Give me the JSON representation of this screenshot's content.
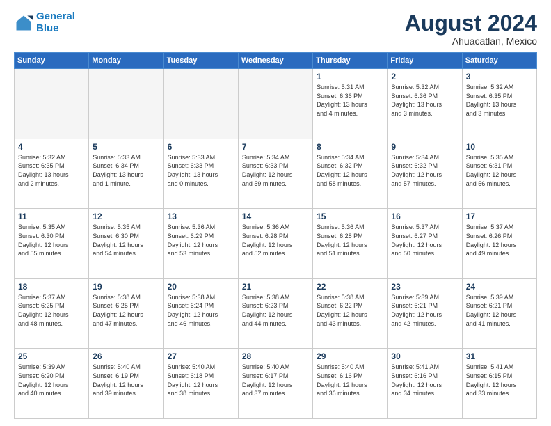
{
  "logo": {
    "line1": "General",
    "line2": "Blue"
  },
  "title": "August 2024",
  "subtitle": "Ahuacatlan, Mexico",
  "days_of_week": [
    "Sunday",
    "Monday",
    "Tuesday",
    "Wednesday",
    "Thursday",
    "Friday",
    "Saturday"
  ],
  "weeks": [
    [
      {
        "day": "",
        "info": ""
      },
      {
        "day": "",
        "info": ""
      },
      {
        "day": "",
        "info": ""
      },
      {
        "day": "",
        "info": ""
      },
      {
        "day": "1",
        "info": "Sunrise: 5:31 AM\nSunset: 6:36 PM\nDaylight: 13 hours\nand 4 minutes."
      },
      {
        "day": "2",
        "info": "Sunrise: 5:32 AM\nSunset: 6:36 PM\nDaylight: 13 hours\nand 3 minutes."
      },
      {
        "day": "3",
        "info": "Sunrise: 5:32 AM\nSunset: 6:35 PM\nDaylight: 13 hours\nand 3 minutes."
      }
    ],
    [
      {
        "day": "4",
        "info": "Sunrise: 5:32 AM\nSunset: 6:35 PM\nDaylight: 13 hours\nand 2 minutes."
      },
      {
        "day": "5",
        "info": "Sunrise: 5:33 AM\nSunset: 6:34 PM\nDaylight: 13 hours\nand 1 minute."
      },
      {
        "day": "6",
        "info": "Sunrise: 5:33 AM\nSunset: 6:33 PM\nDaylight: 13 hours\nand 0 minutes."
      },
      {
        "day": "7",
        "info": "Sunrise: 5:34 AM\nSunset: 6:33 PM\nDaylight: 12 hours\nand 59 minutes."
      },
      {
        "day": "8",
        "info": "Sunrise: 5:34 AM\nSunset: 6:32 PM\nDaylight: 12 hours\nand 58 minutes."
      },
      {
        "day": "9",
        "info": "Sunrise: 5:34 AM\nSunset: 6:32 PM\nDaylight: 12 hours\nand 57 minutes."
      },
      {
        "day": "10",
        "info": "Sunrise: 5:35 AM\nSunset: 6:31 PM\nDaylight: 12 hours\nand 56 minutes."
      }
    ],
    [
      {
        "day": "11",
        "info": "Sunrise: 5:35 AM\nSunset: 6:30 PM\nDaylight: 12 hours\nand 55 minutes."
      },
      {
        "day": "12",
        "info": "Sunrise: 5:35 AM\nSunset: 6:30 PM\nDaylight: 12 hours\nand 54 minutes."
      },
      {
        "day": "13",
        "info": "Sunrise: 5:36 AM\nSunset: 6:29 PM\nDaylight: 12 hours\nand 53 minutes."
      },
      {
        "day": "14",
        "info": "Sunrise: 5:36 AM\nSunset: 6:28 PM\nDaylight: 12 hours\nand 52 minutes."
      },
      {
        "day": "15",
        "info": "Sunrise: 5:36 AM\nSunset: 6:28 PM\nDaylight: 12 hours\nand 51 minutes."
      },
      {
        "day": "16",
        "info": "Sunrise: 5:37 AM\nSunset: 6:27 PM\nDaylight: 12 hours\nand 50 minutes."
      },
      {
        "day": "17",
        "info": "Sunrise: 5:37 AM\nSunset: 6:26 PM\nDaylight: 12 hours\nand 49 minutes."
      }
    ],
    [
      {
        "day": "18",
        "info": "Sunrise: 5:37 AM\nSunset: 6:25 PM\nDaylight: 12 hours\nand 48 minutes."
      },
      {
        "day": "19",
        "info": "Sunrise: 5:38 AM\nSunset: 6:25 PM\nDaylight: 12 hours\nand 47 minutes."
      },
      {
        "day": "20",
        "info": "Sunrise: 5:38 AM\nSunset: 6:24 PM\nDaylight: 12 hours\nand 46 minutes."
      },
      {
        "day": "21",
        "info": "Sunrise: 5:38 AM\nSunset: 6:23 PM\nDaylight: 12 hours\nand 44 minutes."
      },
      {
        "day": "22",
        "info": "Sunrise: 5:38 AM\nSunset: 6:22 PM\nDaylight: 12 hours\nand 43 minutes."
      },
      {
        "day": "23",
        "info": "Sunrise: 5:39 AM\nSunset: 6:21 PM\nDaylight: 12 hours\nand 42 minutes."
      },
      {
        "day": "24",
        "info": "Sunrise: 5:39 AM\nSunset: 6:21 PM\nDaylight: 12 hours\nand 41 minutes."
      }
    ],
    [
      {
        "day": "25",
        "info": "Sunrise: 5:39 AM\nSunset: 6:20 PM\nDaylight: 12 hours\nand 40 minutes."
      },
      {
        "day": "26",
        "info": "Sunrise: 5:40 AM\nSunset: 6:19 PM\nDaylight: 12 hours\nand 39 minutes."
      },
      {
        "day": "27",
        "info": "Sunrise: 5:40 AM\nSunset: 6:18 PM\nDaylight: 12 hours\nand 38 minutes."
      },
      {
        "day": "28",
        "info": "Sunrise: 5:40 AM\nSunset: 6:17 PM\nDaylight: 12 hours\nand 37 minutes."
      },
      {
        "day": "29",
        "info": "Sunrise: 5:40 AM\nSunset: 6:16 PM\nDaylight: 12 hours\nand 36 minutes."
      },
      {
        "day": "30",
        "info": "Sunrise: 5:41 AM\nSunset: 6:16 PM\nDaylight: 12 hours\nand 34 minutes."
      },
      {
        "day": "31",
        "info": "Sunrise: 5:41 AM\nSunset: 6:15 PM\nDaylight: 12 hours\nand 33 minutes."
      }
    ]
  ]
}
